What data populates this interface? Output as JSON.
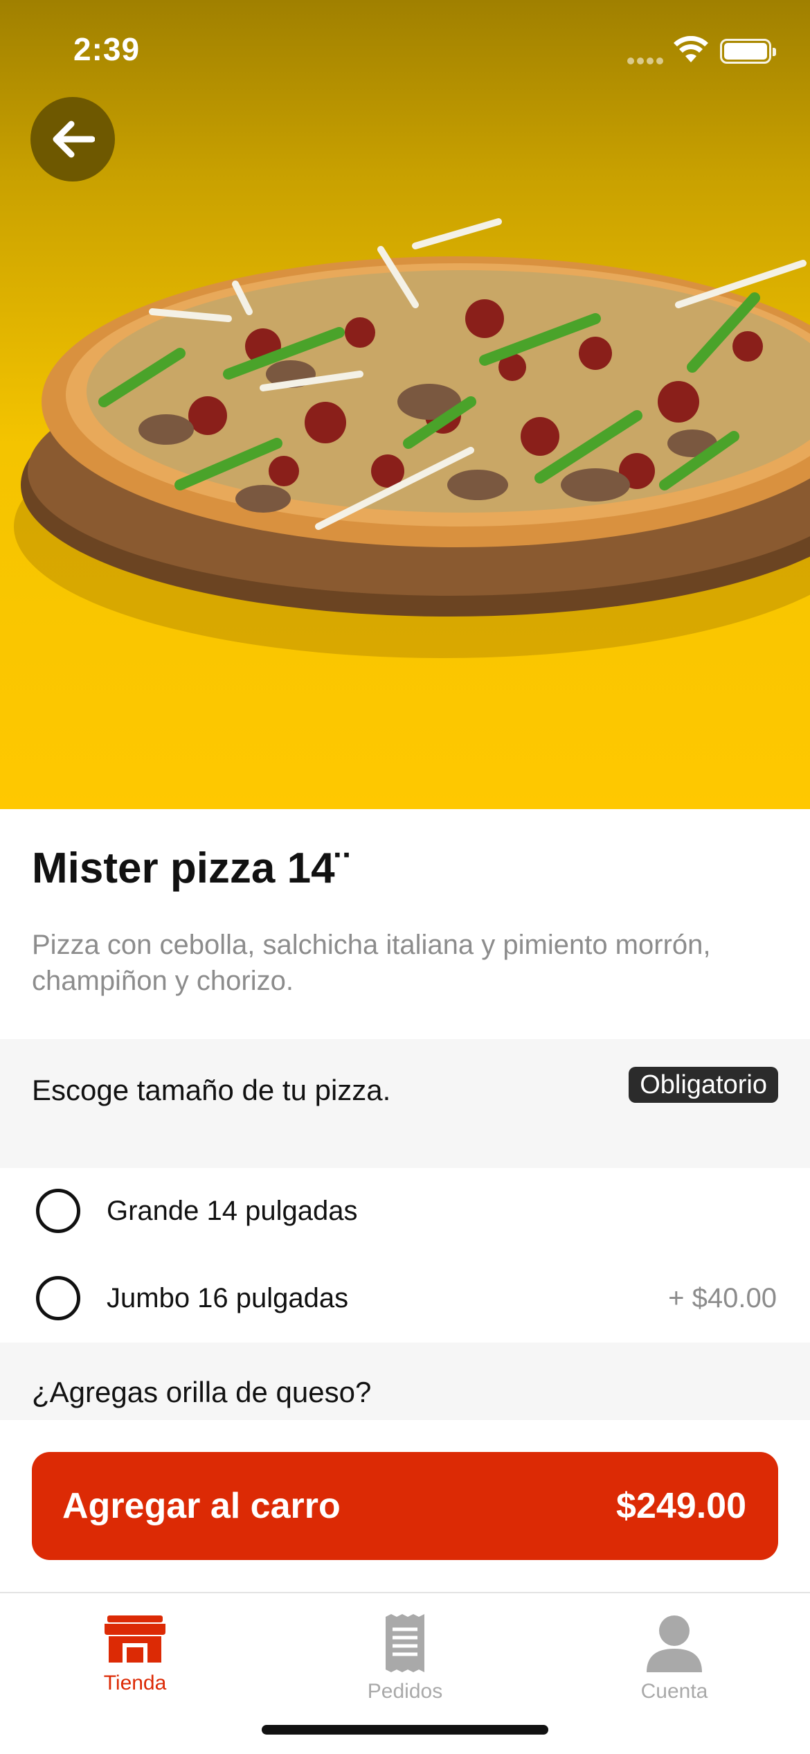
{
  "status_bar": {
    "time": "2:39"
  },
  "colors": {
    "accent": "#dc2a05",
    "hero_yellow": "#ffc800",
    "badge_dark": "#2b2b2b"
  },
  "product": {
    "title": "Mister pizza 14¨",
    "description": "Pizza con cebolla, salchicha italiana y pimiento morrón, champiñon y chorizo."
  },
  "size_section": {
    "title": "Escoge tamaño de tu pizza.",
    "badge": "Obligatorio",
    "options": [
      {
        "label": "Grande 14 pulgadas",
        "price": ""
      },
      {
        "label": "Jumbo 16 pulgadas",
        "price": "+ $40.00"
      }
    ]
  },
  "cheese_section": {
    "title": "¿Agregas orilla de queso?"
  },
  "cart_button": {
    "label": "Agregar al carro",
    "price": "$249.00"
  },
  "tab_bar": {
    "tabs": [
      {
        "label": "Tienda",
        "icon": "store-icon",
        "active": true
      },
      {
        "label": "Pedidos",
        "icon": "receipt-icon",
        "active": false
      },
      {
        "label": "Cuenta",
        "icon": "person-icon",
        "active": false
      }
    ]
  }
}
